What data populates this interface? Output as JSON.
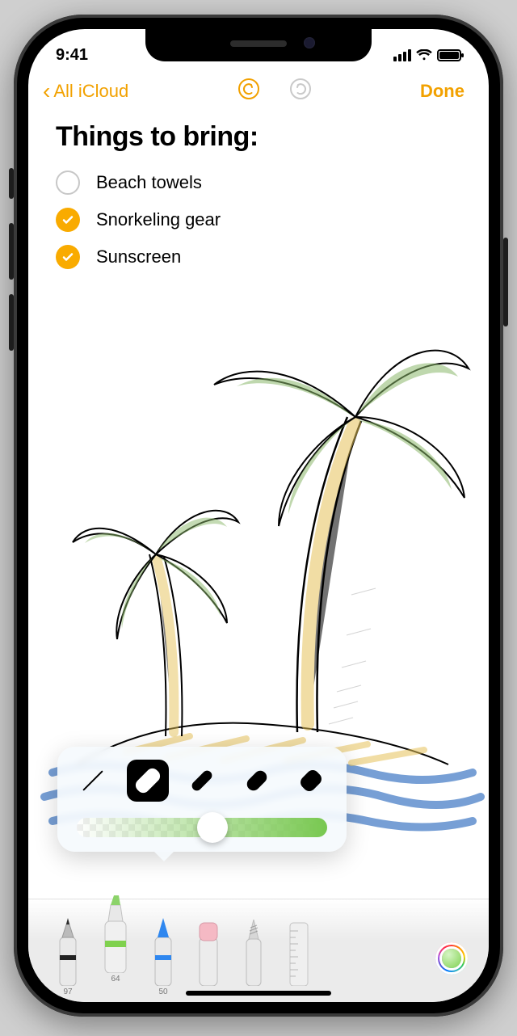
{
  "status": {
    "time": "9:41"
  },
  "nav": {
    "back_label": "All iCloud",
    "done_label": "Done"
  },
  "note": {
    "title": "Things to bring:",
    "items": [
      {
        "label": "Beach towels",
        "checked": false
      },
      {
        "label": "Snorkeling gear",
        "checked": true
      },
      {
        "label": "Sunscreen",
        "checked": true
      }
    ]
  },
  "stroke_popover": {
    "options": [
      {
        "name": "thin",
        "size": 1,
        "selected": false
      },
      {
        "name": "light",
        "size": 20,
        "selected": true
      },
      {
        "name": "small",
        "size": 12,
        "selected": false
      },
      {
        "name": "medium",
        "size": 16,
        "selected": false
      },
      {
        "name": "large",
        "size": 20,
        "selected": false
      }
    ],
    "opacity_percent": 54
  },
  "tools": {
    "items": [
      {
        "name": "pen",
        "label": "97",
        "selected": false
      },
      {
        "name": "marker",
        "label": "64",
        "selected": true
      },
      {
        "name": "pencil",
        "label": "50",
        "selected": false
      },
      {
        "name": "eraser",
        "label": "",
        "selected": false
      },
      {
        "name": "lasso",
        "label": "",
        "selected": false
      },
      {
        "name": "ruler",
        "label": "",
        "selected": false
      }
    ],
    "picker_color": "#7fd14e"
  }
}
